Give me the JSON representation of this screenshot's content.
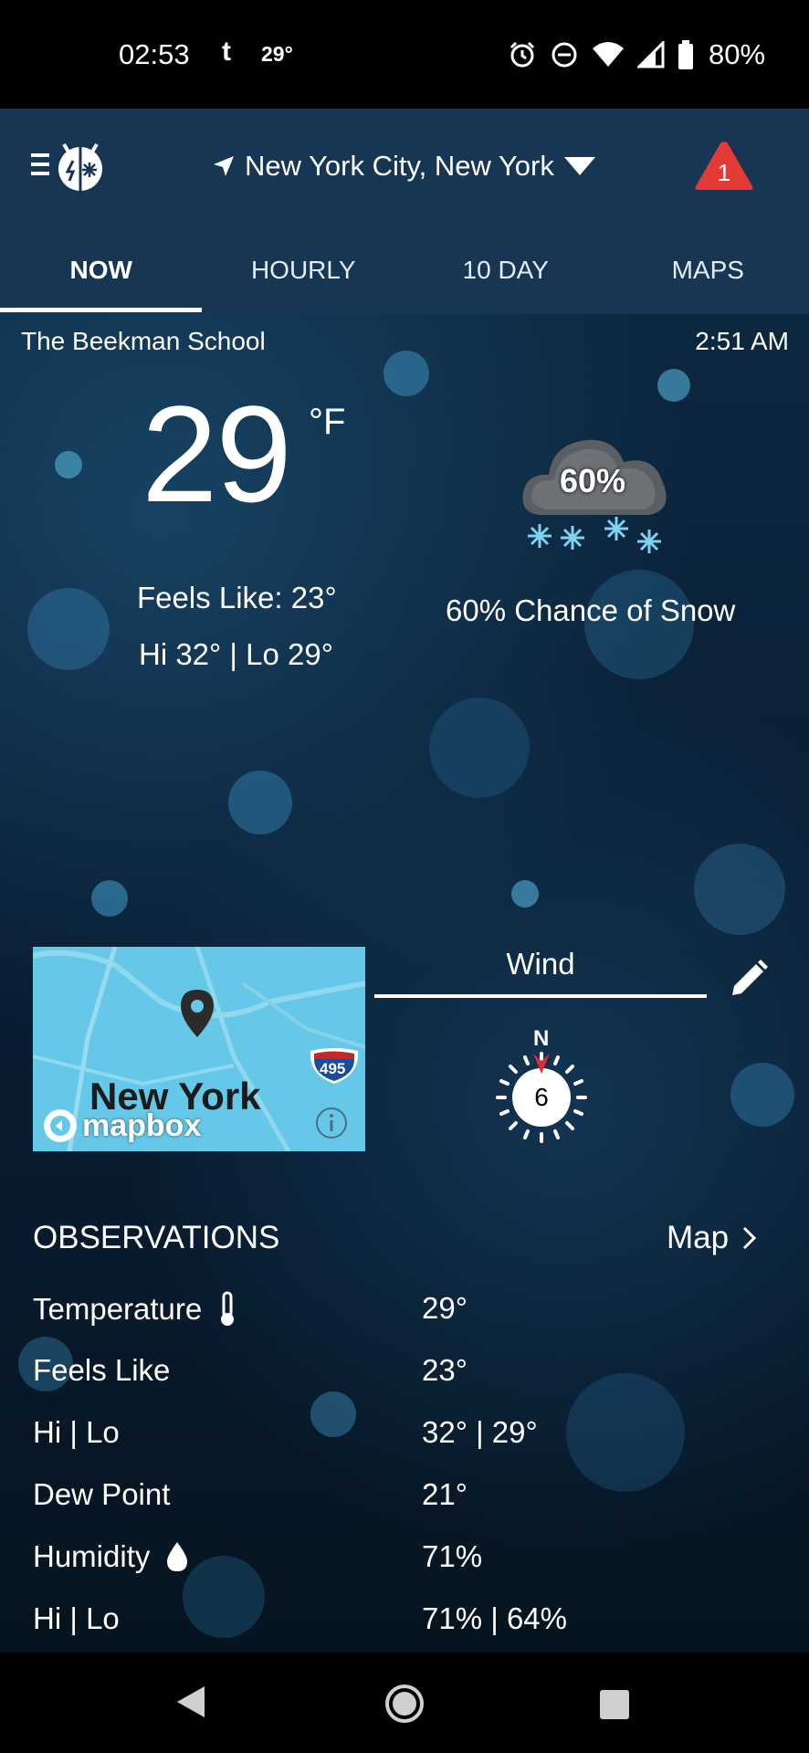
{
  "status_bar": {
    "time": "02:53",
    "app_letter": "t",
    "temp": "29°",
    "battery": "80%"
  },
  "header": {
    "location": "New York City, New York",
    "alert_count": "1",
    "tabs": [
      "NOW",
      "HOURLY",
      "10 DAY",
      "MAPS"
    ],
    "active_tab": "NOW"
  },
  "current": {
    "station": "The Beekman School",
    "time": "2:51 AM",
    "temperature": "29",
    "unit": "°F",
    "feels_like": "Feels Like: 23°",
    "hi_lo": "Hi 32° | Lo 29°",
    "precip_percent": "60%",
    "condition": "60% Chance of Snow"
  },
  "map": {
    "city_label": "New York",
    "brand": "mapbox",
    "highway": "495"
  },
  "wind": {
    "label": "Wind",
    "direction": "N",
    "speed": "6"
  },
  "observations": {
    "title": "OBSERVATIONS",
    "map_link": "Map",
    "rows": [
      {
        "label": "Temperature",
        "value": "29°",
        "icon": "thermometer-icon"
      },
      {
        "label": "Feels Like",
        "value": "23°"
      },
      {
        "label": "Hi | Lo",
        "value": "32° | 29°"
      },
      {
        "label": "Dew Point",
        "value": "21°"
      },
      {
        "label": "Humidity",
        "value": "71%",
        "icon": "droplet-icon"
      },
      {
        "label": "Hi | Lo",
        "value": "71% | 64%"
      }
    ]
  },
  "colors": {
    "header_bg": "#163654",
    "alert_red": "#e53935",
    "map_water": "#65c8e8"
  }
}
